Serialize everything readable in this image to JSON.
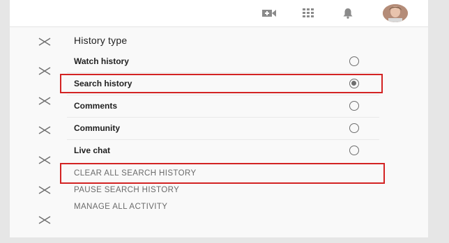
{
  "header": {
    "icons": [
      "video-camera-add-icon",
      "apps-grid-icon",
      "notification-bell-icon",
      "user-avatar"
    ]
  },
  "panel": {
    "title": "History type",
    "options": [
      {
        "label": "Watch history",
        "selected": false
      },
      {
        "label": "Search history",
        "selected": true
      },
      {
        "label": "Comments",
        "selected": false
      },
      {
        "label": "Community",
        "selected": false
      },
      {
        "label": "Live chat",
        "selected": false
      }
    ],
    "actions": [
      "CLEAR ALL SEARCH HISTORY",
      "PAUSE SEARCH HISTORY",
      "MANAGE ALL ACTIVITY"
    ]
  },
  "colors": {
    "highlight": "#d32323",
    "radio": "#6e6e6e",
    "action_text": "#6a6a6a"
  }
}
